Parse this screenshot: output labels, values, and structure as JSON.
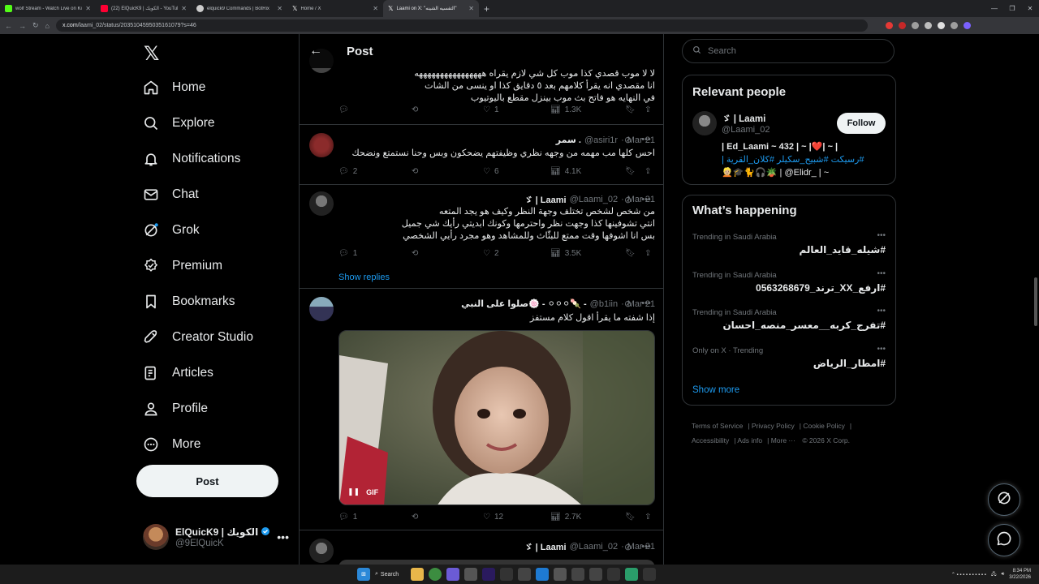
{
  "browser": {
    "tabs": [
      {
        "label": "wolf Stream - Watch Live on Ki",
        "color": "#53fc18"
      },
      {
        "label": "(22) ElQuicK9 | الكويك - YouTube",
        "color": "#ff0033"
      },
      {
        "label": "elquick9 Commands | BotRix",
        "color": "#cccccc"
      },
      {
        "label": "Home / X",
        "color": "#ffffff"
      },
      {
        "label": "Laami on X: \"التفسيه الشينه\"",
        "color": "#ffffff"
      }
    ],
    "url_domain": "x.com",
    "url_path": "/laami_02/status/2035104595035161079?s=46"
  },
  "sidebar": {
    "logo": "𝕏",
    "items": [
      {
        "label": "Home",
        "icon": "home-icon"
      },
      {
        "label": "Explore",
        "icon": "search-icon"
      },
      {
        "label": "Notifications",
        "icon": "bell-icon"
      },
      {
        "label": "Chat",
        "icon": "mail-icon"
      },
      {
        "label": "Grok",
        "icon": "grok-icon"
      },
      {
        "label": "Premium",
        "icon": "premium-icon"
      },
      {
        "label": "Bookmarks",
        "icon": "bookmark-icon"
      },
      {
        "label": "Creator Studio",
        "icon": "rocket-icon"
      },
      {
        "label": "Articles",
        "icon": "articles-icon"
      },
      {
        "label": "Profile",
        "icon": "person-icon"
      },
      {
        "label": "More",
        "icon": "more-circle-icon"
      }
    ],
    "post_label": "Post",
    "account": {
      "name": "ElQuicK9 | الكويك",
      "handle": "@9ElQuicK"
    }
  },
  "main": {
    "title": "Post",
    "tweets": [
      {
        "text": "لا لا موب قصدي كذا موب كل شي لازم يقراه ههههههههههههههههه\nانا مقصدي انه يقرأ كلامهم بعد ٥ دقايق كذا او ينسى من الشات\nفي النهايه هو فاتح بث موب بينزل مقطع باليوتيوب",
        "replies": "",
        "reposts": "",
        "likes": "1",
        "views": "1.3K"
      },
      {
        "name": "سمر .",
        "handle": "@asiri1r",
        "date": "Mar 21",
        "text": "احس كلها مب مهمه من وجهه نظري وظيفتهم يضحكون وبس وحنا نستمتع ونضحك",
        "replies": "2",
        "reposts": "",
        "likes": "6",
        "views": "4.1K"
      },
      {
        "name": "ゞ | Laami",
        "handle": "@Laami_02",
        "date": "Mar 21",
        "text": "من شخص لشخص تختلف وجهة النظر وكيف هو يجد المتعه\nانتي تشوفينها كذا وجهت نظر واحترمها وكونك ابديتي رأيك شي جميل\nبس انا اشوفها وقت ممتع للبثّاث وللمشاهد وهو مجرد رأيي الشخصي",
        "replies": "1",
        "reposts": "",
        "likes": "2",
        "views": "3.5K"
      },
      {
        "name": "صلوا على النبي🍥 - ⚪⚪⚪🍡 -",
        "handle": "@b1iin",
        "date": "Mar 21",
        "text": "إذا شفته ما يقرأ اقول كلام مستفز",
        "gif_label": "GIF",
        "replies": "1",
        "reposts": "",
        "likes": "12",
        "views": "2.7K"
      },
      {
        "name": "ゞ | Laami",
        "handle": "@Laami_02",
        "date": "Mar 21"
      }
    ],
    "show_replies": "Show replies"
  },
  "right": {
    "search_placeholder": "Search",
    "relevant": {
      "title": "Relevant people",
      "name": "ゞ | Laami",
      "handle": "@Laami_02",
      "follow": "Follow",
      "bio_line1": "| Ed_Laami ~ 432 | ~ |❤️| ~ |",
      "bio_line2": "#رسيكت #شبيح_سكيلر #كلان_القرية |",
      "bio_line3": "👱🏼🎓🐈🎧🪴 | @Elidr_ | ~",
      "bio_mention": "@Elidr_"
    },
    "happening": {
      "title": "What’s happening",
      "trends": [
        {
          "category": "Trending in Saudi Arabia",
          "tag": "#شيله_قايد_العالم"
        },
        {
          "category": "Trending in Saudi Arabia",
          "tag": "#ارفع_XX_ترند_0563268679"
        },
        {
          "category": "Trending in Saudi Arabia",
          "tag": "#تفرج_كربه__معسر_منصه_احسان"
        },
        {
          "category": "Only on X · Trending",
          "tag": "#امطار_الرياض"
        }
      ],
      "show_more": "Show more"
    },
    "footer": [
      "Terms of Service",
      "Privacy Policy",
      "Cookie Policy",
      "Accessibility",
      "Ads info",
      "More ···",
      "© 2026 X Corp."
    ]
  },
  "taskbar": {
    "search": "Search",
    "time": "8:34 PM",
    "date": "3/22/2026"
  }
}
